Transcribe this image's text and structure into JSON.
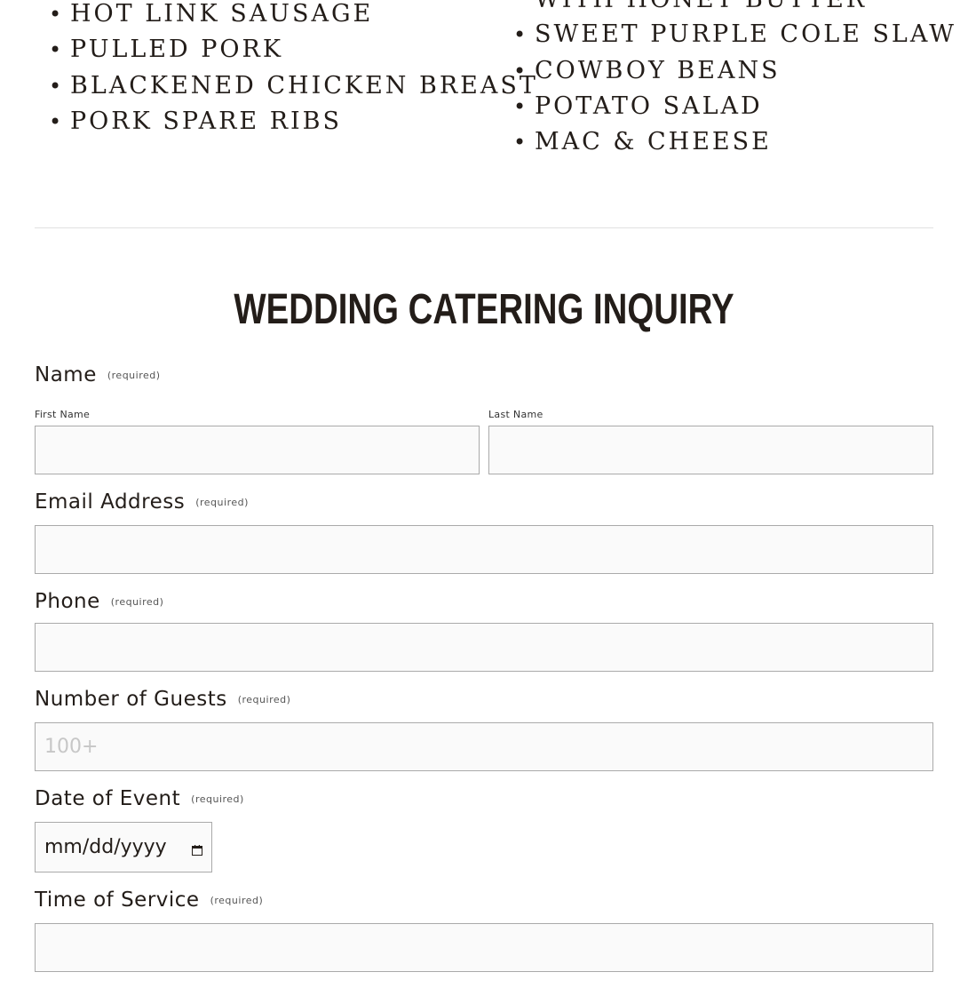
{
  "menu": {
    "left_items": [
      "HOT LINK SAUSAGE",
      "PULLED PORK",
      "BLACKENED CHICKEN BREAST",
      "PORK SPARE RIBS"
    ],
    "right_partial": "WITH HONEY BUTTER",
    "right_items": [
      "SWEET PURPLE COLE SLAW",
      "COWBOY BEANS",
      "POTATO SALAD",
      "MAC & CHEESE"
    ]
  },
  "form": {
    "title": "WEDDING CATERING INQUIRY",
    "required_text": "(required)",
    "name": {
      "label": "Name",
      "first_label": "First Name",
      "last_label": "Last Name",
      "first_value": "",
      "last_value": ""
    },
    "email": {
      "label": "Email Address",
      "value": ""
    },
    "phone": {
      "label": "Phone",
      "value": ""
    },
    "guests": {
      "label": "Number of Guests",
      "placeholder": "100+",
      "value": ""
    },
    "date": {
      "label": "Date of Event",
      "placeholder": "mm/dd/yyyy"
    },
    "time": {
      "label": "Time of Service",
      "value": ""
    }
  },
  "colors": {
    "text": "#231d19",
    "input_background": "#fafafa",
    "input_border": "#aaaaaa",
    "divider": "#e1e1e1"
  },
  "icons": {
    "bullet": "disc",
    "date_picker": "calendar-icon"
  }
}
